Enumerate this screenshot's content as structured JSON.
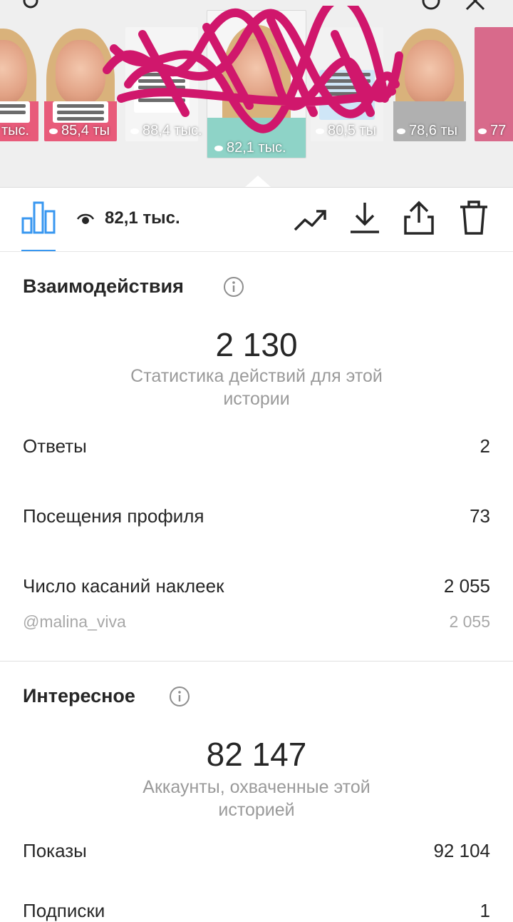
{
  "stories": [
    {
      "views": "тыс."
    },
    {
      "views": "85,4 ты"
    },
    {
      "views": "88,4 тыс."
    },
    {
      "views": "82,1 тыс."
    },
    {
      "views": "80,5 ты"
    },
    {
      "views": "78,6 ты"
    },
    {
      "views": "77"
    }
  ],
  "toolbar": {
    "views": "82,1 тыс."
  },
  "interactions": {
    "title": "Взаимодействия",
    "total": "2 130",
    "caption": "Статистика действий для этой истории",
    "rows": [
      {
        "label": "Ответы",
        "value": "2"
      },
      {
        "label": "Посещения профиля",
        "value": "73"
      },
      {
        "label": "Число касаний наклеек",
        "value": "2 055"
      }
    ],
    "sticker": {
      "label": "@malina_viva",
      "value": "2 055"
    }
  },
  "discovery": {
    "title": "Интересное",
    "total": "82 147",
    "caption": "Аккаунты, охваченные этой историей",
    "rows": [
      {
        "label": "Показы",
        "value": "92 104"
      },
      {
        "label": "Подписки",
        "value": "1"
      }
    ]
  },
  "colors": {
    "accent": "#3897f0",
    "text": "#262626",
    "muted": "#9a9a9a",
    "scribble": "#d0176c"
  }
}
